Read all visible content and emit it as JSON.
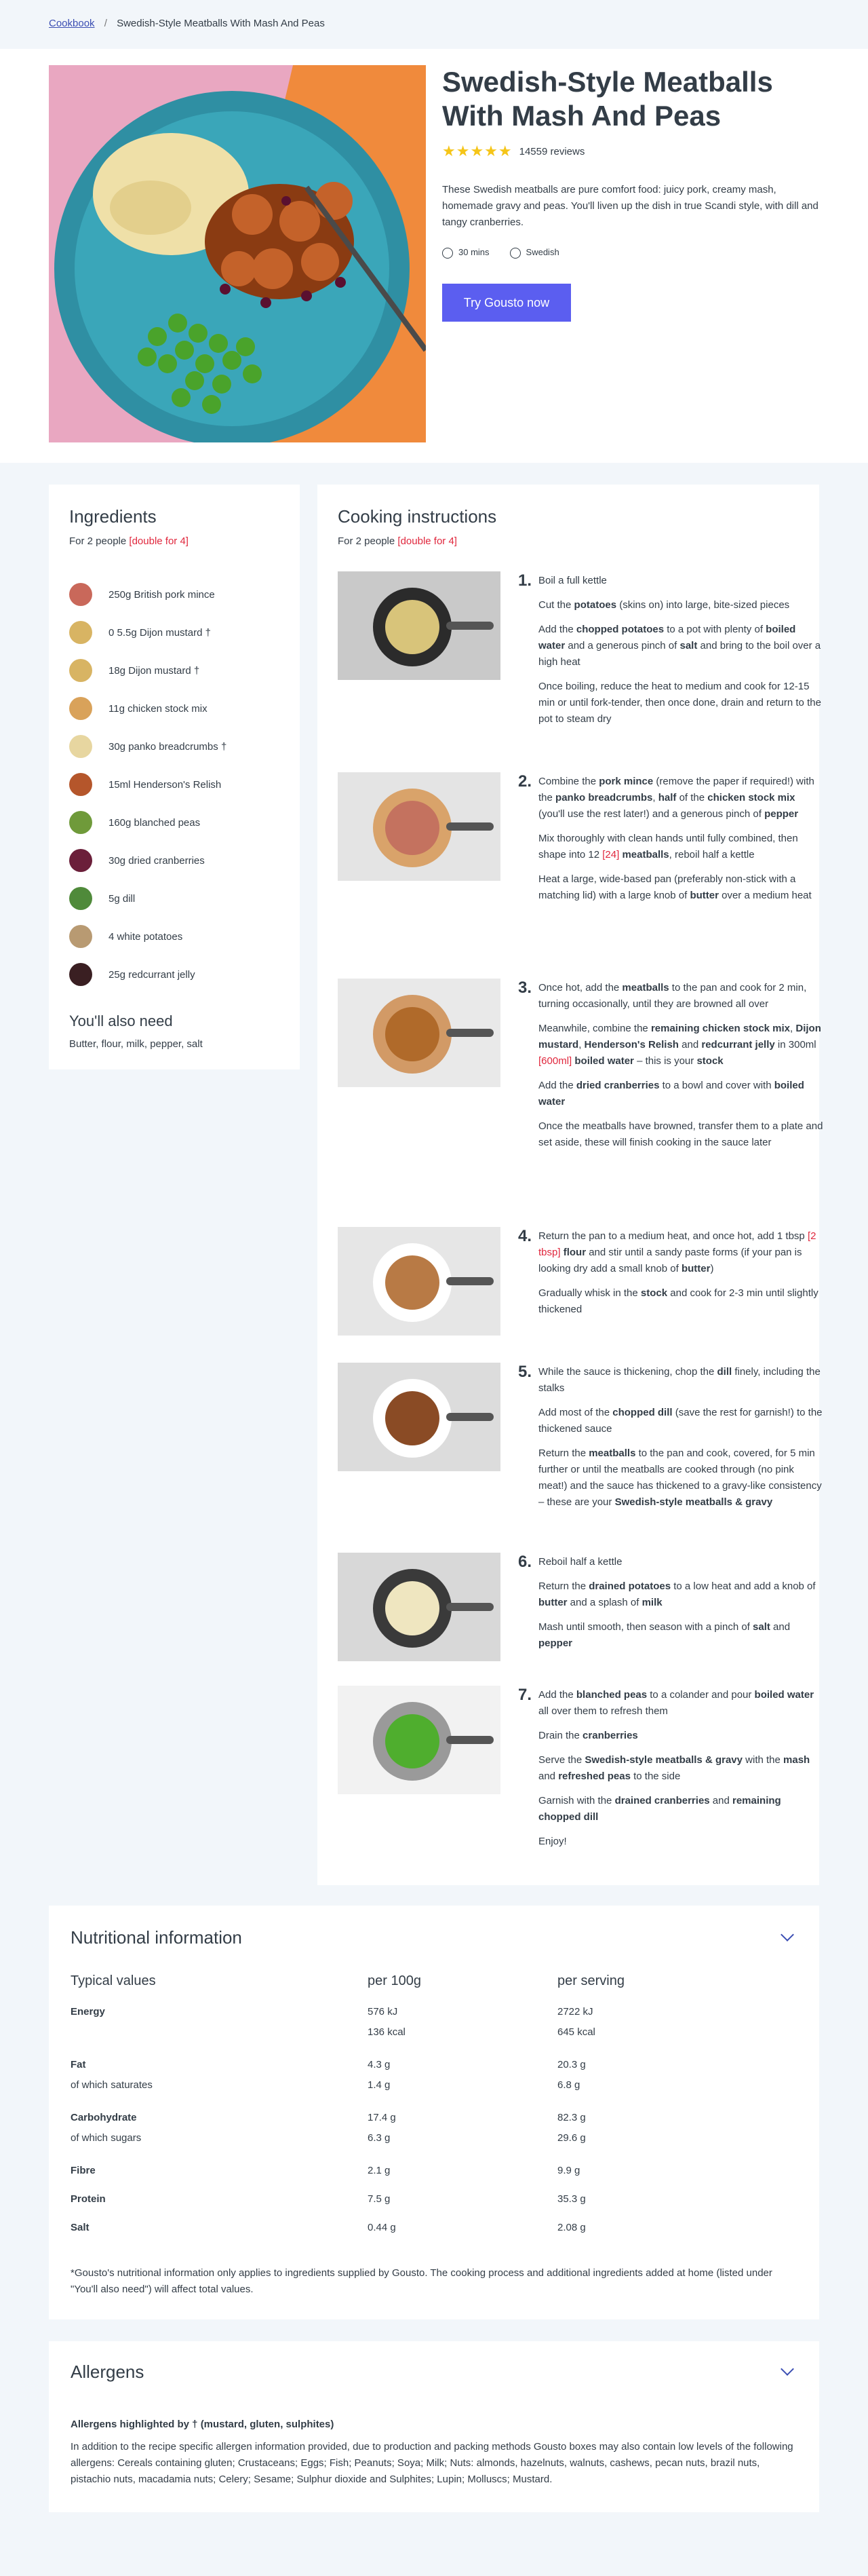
{
  "breadcrumb": {
    "home": "Cookbook",
    "separator": "/",
    "current": "Swedish-Style Meatballs With Mash And Peas"
  },
  "recipe": {
    "title": "Swedish-Style Meatballs With Mash And Peas",
    "rating_stars": 4.5,
    "stars_text": "★★★★★",
    "reviews": "14559 reviews",
    "description": "These Swedish meatballs are pure comfort food: juicy pork, creamy mash, homemade gravy and peas. You'll liven up the dish in true Scandi style, with dill and tangy cranberries.",
    "time": "30 mins",
    "cuisine": "Swedish",
    "cta": "Try Gousto now"
  },
  "ingredients": {
    "title": "Ingredients",
    "for_people": "For 2 people",
    "double": "[double for 4]",
    "items": [
      {
        "text": "250g British pork mince",
        "color": "#c9685a"
      },
      {
        "text": "0 5.5g Dijon mustard †",
        "color": "#d8b463"
      },
      {
        "text": "18g Dijon mustard †",
        "color": "#d8b463"
      },
      {
        "text": "11g chicken stock mix",
        "color": "#d9a25a"
      },
      {
        "text": "30g panko breadcrumbs †",
        "color": "#e7d6a0"
      },
      {
        "text": "15ml Henderson's Relish",
        "color": "#b5562b"
      },
      {
        "text": "160g blanched peas",
        "color": "#6f9a3a"
      },
      {
        "text": "30g dried cranberries",
        "color": "#6b1f3a"
      },
      {
        "text": "5g dill",
        "color": "#4f8a3a"
      },
      {
        "text": "4 white potatoes",
        "color": "#b89a72"
      },
      {
        "text": "25g redcurrant jelly",
        "color": "#3a1f22"
      }
    ],
    "also_need_title": "You'll also need",
    "also_need": "Butter, flour, milk, pepper, salt"
  },
  "instructions": {
    "title": "Cooking instructions",
    "for_people": "For 2 people",
    "double": "[double for 4]",
    "steps": [
      {
        "num": "1.",
        "html": "<p>Boil a full kettle</p><p>Cut the <b>potatoes</b> (skins on) into large, bite-sized pieces</p><p>Add the <b>chopped potatoes</b> to a pot with plenty of <b>boiled water</b> and a generous pinch of <b>salt</b> and bring to the boil over a high heat</p><p>Once boiling, reduce the heat to medium and cook for 12-15 min or until fork-tender, then once done, drain and return to the pot to steam dry</p>"
      },
      {
        "num": "2.",
        "html": "<p>Combine the <b>pork mince</b> (remove the paper if required!) with the <b>panko breadcrumbs</b>, <b>half</b> of the <b>chicken stock mix</b> (you'll use the rest later!) and a generous pinch of <b>pepper</b></p><p>Mix thoroughly with clean hands until fully combined, then shape into 12 <span class=\"red\">[24]</span> <b>meatballs</b>, reboil half a kettle</p><p>Heat a large, wide-based pan (preferably non-stick with a matching lid) with a large knob of <b>butter</b> over a medium heat</p>"
      },
      {
        "num": "3.",
        "html": "<p>Once hot, add the <b>meatballs</b> to the pan and cook for 2 min, turning occasionally, until they are browned all over</p><p>Meanwhile, combine the <b>remaining chicken stock mix</b>, <b>Dijon mustard</b>, <b>Henderson's Relish</b> and <b>redcurrant jelly</b> in 300ml <span class=\"red\">[600ml]</span> <b>boiled water</b> – this is your <b>stock</b></p><p>Add the <b>dried cranberries</b> to a bowl and cover with <b>boiled water</b></p><p>Once the meatballs have browned, transfer them to a plate and set aside, these will finish cooking in the sauce later</p>"
      },
      {
        "num": "4.",
        "html": "<p>Return the pan to a medium heat, and once hot, add 1 tbsp <span class=\"red\">[2 tbsp]</span> <b>flour</b> and stir until a sandy paste forms (if your pan is looking dry add a small knob of <b>butter</b>)</p><p>Gradually whisk in the <b>stock</b> and cook for 2-3 min until slightly thickened</p>"
      },
      {
        "num": "5.",
        "html": "<p>While the sauce is thickening, chop the <b>dill</b> finely, including the stalks</p><p>Add most of the <b>chopped dill</b> (save the rest for garnish!) to the thickened sauce</p><p>Return the <b>meatballs</b> to the pan and cook, covered, for 5 min further or until the meatballs are cooked through (no pink meat!) and the sauce has thickened to a gravy-like consistency – these are your <b>Swedish-style meatballs &amp; gravy</b></p>"
      },
      {
        "num": "6.",
        "html": "<p>Reboil half a kettle</p><p>Return the <b>drained potatoes</b> to a low heat and add a knob of <b>butter</b> and a splash of <b>milk</b></p><p>Mash until smooth, then season with a pinch of <b>salt</b> and <b>pepper</b></p>"
      },
      {
        "num": "7.",
        "html": "<p>Add the <b>blanched peas</b> to a colander and pour <b>boiled water</b> all over them to refresh them</p><p>Drain the <b>cranberries</b></p><p>Serve the <b>Swedish-style meatballs &amp; gravy</b> with the <b>mash</b> and <b>refreshed peas</b> to the side</p><p>Garnish with the <b>drained cranberries</b> and <b>remaining chopped dill</b></p><p>Enjoy!</p>"
      }
    ]
  },
  "nutrition": {
    "title": "Nutritional information",
    "headers": [
      "Typical values",
      "per 100g",
      "per serving"
    ],
    "rows": [
      {
        "label": "Energy",
        "bold": true,
        "per100": "576 kJ",
        "serving": "2722 kJ"
      },
      {
        "label": "",
        "bold": false,
        "per100": "136 kcal",
        "serving": "645 kcal"
      },
      {
        "label": "Fat",
        "bold": true,
        "per100": "4.3 g",
        "serving": "20.3 g"
      },
      {
        "label": "of which saturates",
        "bold": false,
        "per100": "1.4 g",
        "serving": "6.8 g"
      },
      {
        "label": "Carbohydrate",
        "bold": true,
        "per100": "17.4 g",
        "serving": "82.3 g"
      },
      {
        "label": "of which sugars",
        "bold": false,
        "per100": "6.3 g",
        "serving": "29.6 g"
      },
      {
        "label": "Fibre",
        "bold": true,
        "per100": "2.1 g",
        "serving": "9.9 g"
      },
      {
        "label": "Protein",
        "bold": true,
        "per100": "7.5 g",
        "serving": "35.3 g"
      },
      {
        "label": "Salt",
        "bold": true,
        "per100": "0.44 g",
        "serving": "2.08 g"
      }
    ],
    "footnote": "*Gousto's nutritional information only applies to ingredients supplied by Gousto. The cooking process and additional ingredients added at home (listed under \"You'll also need\") will affect total values."
  },
  "allergens": {
    "title": "Allergens",
    "highlighted": "Allergens highlighted by † (mustard, gluten, sulphites)",
    "text": "In addition to the recipe specific allergen information provided, due to production and packing methods Gousto boxes may also contain low levels of the following allergens: Cereals containing gluten; Crustaceans; Eggs; Fish; Peanuts; Soya; Milk; Nuts: almonds, hazelnuts, walnuts, cashews, pecan nuts, brazil nuts, pistachio nuts, macadamia nuts; Celery; Sesame; Sulphur dioxide and Sulphites; Lupin; Molluscs; Mustard."
  },
  "colors": {
    "accent": "#5b5ef0",
    "link": "#3b4eb3",
    "red": "#e0273d",
    "star": "#f5c518"
  }
}
